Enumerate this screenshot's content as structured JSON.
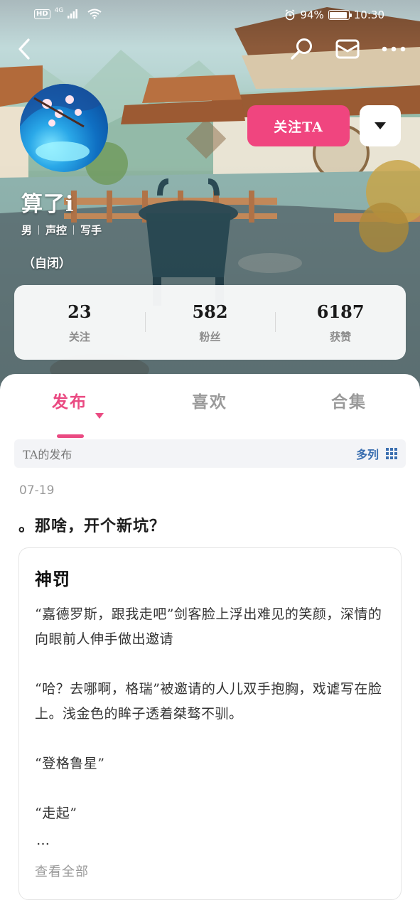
{
  "status_bar": {
    "hd": "HD",
    "network": "4G",
    "battery_percent": "94%",
    "battery_level": 0.94,
    "time": "10:30"
  },
  "nav": {
    "icons": [
      "back-arrow-icon",
      "search-icon",
      "mail-icon",
      "more-icon"
    ]
  },
  "profile": {
    "name": "算了i",
    "tags": [
      "男",
      "声控",
      "写手"
    ],
    "bio": "（自闭）",
    "follow_label": "关注TA"
  },
  "stats": [
    {
      "value": "23",
      "label": "关注"
    },
    {
      "value": "582",
      "label": "粉丝"
    },
    {
      "value": "6187",
      "label": "获赞"
    }
  ],
  "tabs": [
    {
      "label": "发布",
      "active": true
    },
    {
      "label": "喜欢",
      "active": false
    },
    {
      "label": "合集",
      "active": false
    }
  ],
  "section": {
    "title": "TA的发布",
    "view_label": "多列"
  },
  "post": {
    "date": "07-19",
    "text": "。那啥，开个新坑？",
    "article": {
      "title": "神罚",
      "paragraphs": [
        "“嘉德罗斯，跟我走吧”剑客脸上浮出难见的笑颜，深情的向眼前人伸手做出邀请",
        "“哈？去哪啊，格瑞”被邀请的人儿双手抱胸，戏谑写在脸上。浅金色的眸子透着桀骜不驯。",
        "“登格鲁星”",
        "“走起”"
      ],
      "ellipsis": "…",
      "more_label": "查看全部"
    }
  },
  "colors": {
    "accent_pink": "#f0457f",
    "tab_active": "#ea4a82",
    "link_blue": "#3b6fb0"
  }
}
